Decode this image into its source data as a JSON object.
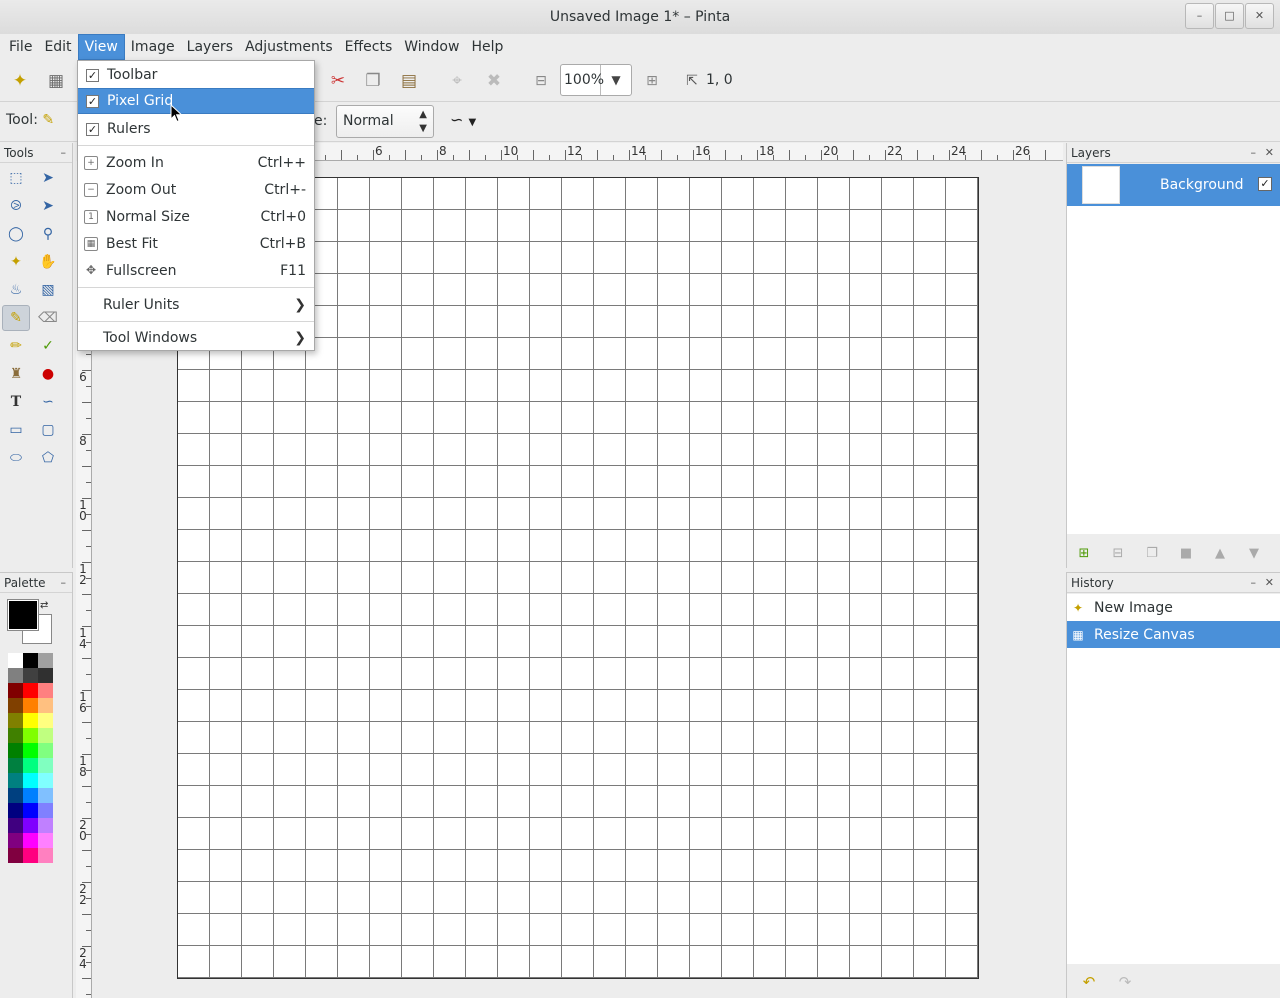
{
  "window": {
    "title": "Unsaved Image 1* – Pinta",
    "buttons": [
      "–",
      "□",
      "✕"
    ]
  },
  "menubar": {
    "items": [
      "File",
      "Edit",
      "View",
      "Image",
      "Layers",
      "Adjustments",
      "Effects",
      "Window",
      "Help"
    ],
    "active": "View"
  },
  "toolbar": {
    "zoom_value": "100%",
    "coords": "1, 0"
  },
  "tool_options": {
    "tool_label": "Tool:",
    "blend_label_partial": "e:",
    "blend_mode": "Normal"
  },
  "view_menu": {
    "items": [
      {
        "label": "Toolbar",
        "checked": true,
        "accel": ""
      },
      {
        "label": "Pixel Grid",
        "checked": true,
        "accel": ""
      },
      {
        "label": "Rulers",
        "checked": true,
        "accel": ""
      },
      {
        "label": "Zoom In",
        "accel": "Ctrl++"
      },
      {
        "label": "Zoom Out",
        "accel": "Ctrl+-"
      },
      {
        "label": "Normal Size",
        "accel": "Ctrl+0"
      },
      {
        "label": "Best Fit",
        "accel": "Ctrl+B"
      },
      {
        "label": "Fullscreen",
        "accel": "F11"
      },
      {
        "label": "Ruler Units",
        "submenu": true
      },
      {
        "label": "Tool Windows",
        "submenu": true
      }
    ],
    "highlighted": "Pixel Grid"
  },
  "tools_panel": {
    "title": "Tools",
    "selected_tool": "paintbrush"
  },
  "palette_panel": {
    "title": "Palette",
    "primary_color": "#000000",
    "secondary_color": "#ffffff",
    "swatches": [
      "#ffffff",
      "#000000",
      "#a0a0a0",
      "#808080",
      "#404040",
      "#303030",
      "#800000",
      "#ff0000",
      "#ff8080",
      "#804000",
      "#ff8000",
      "#ffc080",
      "#808000",
      "#ffff00",
      "#ffff80",
      "#408000",
      "#80ff00",
      "#c0ff80",
      "#008000",
      "#00ff00",
      "#80ff80",
      "#008040",
      "#00ff80",
      "#80ffc0",
      "#008080",
      "#00ffff",
      "#80ffff",
      "#004080",
      "#0080ff",
      "#80c0ff",
      "#000080",
      "#0000ff",
      "#8080ff",
      "#400080",
      "#8000ff",
      "#c080ff",
      "#800080",
      "#ff00ff",
      "#ff80ff",
      "#800040",
      "#ff0080",
      "#ff80c0"
    ]
  },
  "rulers": {
    "h_labels": [
      "6",
      "8",
      "10",
      "12",
      "14",
      "16",
      "18",
      "20",
      "22",
      "24",
      "26"
    ],
    "v_labels": [
      "6",
      "8",
      "10",
      "12",
      "14",
      "16",
      "18",
      "20",
      "22",
      "24"
    ]
  },
  "layers_panel": {
    "title": "Layers",
    "layers": [
      {
        "name": "Background",
        "visible": true
      }
    ]
  },
  "history_panel": {
    "title": "History",
    "items": [
      "New Image",
      "Resize Canvas"
    ],
    "selected": "Resize Canvas"
  },
  "colors": {
    "accent": "#4a90d9"
  }
}
